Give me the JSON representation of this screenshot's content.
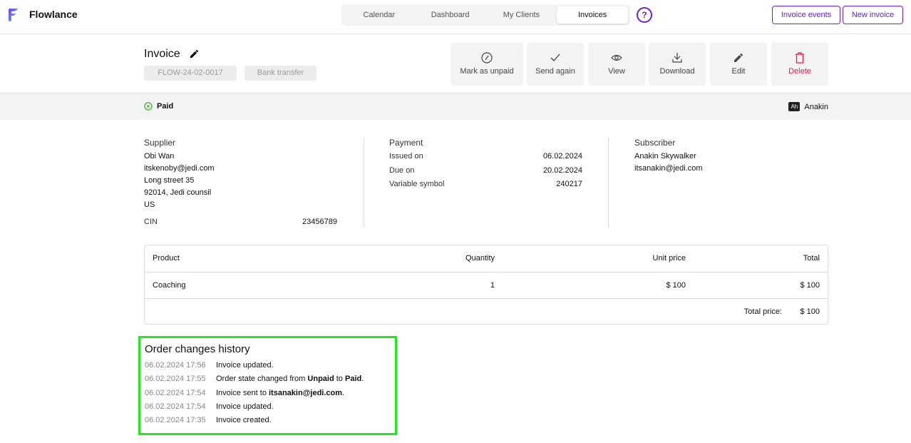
{
  "app": {
    "name": "Flowlance"
  },
  "nav": {
    "tabs": [
      {
        "label": "Calendar"
      },
      {
        "label": "Dashboard"
      },
      {
        "label": "My Clients"
      },
      {
        "label": "Invoices",
        "active": true
      }
    ],
    "help": "?",
    "invoice_events": "Invoice events",
    "new_invoice": "New invoice"
  },
  "invoice": {
    "title": "Invoice",
    "number": "FLOW-24-02-0017",
    "payment_method": "Bank transfer"
  },
  "actions": [
    {
      "label": "Mark as unpaid",
      "icon": "slash-circle-icon"
    },
    {
      "label": "Send again",
      "icon": "check-icon"
    },
    {
      "label": "View",
      "icon": "eye-icon"
    },
    {
      "label": "Download",
      "icon": "download-icon"
    },
    {
      "label": "Edit",
      "icon": "pencil-icon"
    },
    {
      "label": "Delete",
      "icon": "trash-icon",
      "color": "#e8174f"
    }
  ],
  "status": {
    "label": "Paid",
    "color": "#7cbf6b",
    "user_initials": "Ah",
    "user": "Anakin"
  },
  "supplier": {
    "heading": "Supplier",
    "lines": [
      "Obi Wan",
      "itskenoby@jedi.com",
      "Long street 35",
      "92014, Jedi counsil",
      "US"
    ],
    "cin_label": "CIN",
    "cin": "23456789"
  },
  "payment": {
    "heading": "Payment",
    "rows": [
      {
        "k": "Issued on",
        "v": "06.02.2024"
      },
      {
        "k": "Due on",
        "v": "20.02.2024"
      },
      {
        "k": "Variable symbol",
        "v": "240217"
      }
    ]
  },
  "subscriber": {
    "heading": "Subscriber",
    "lines": [
      "Anakin Skywalker",
      "itsanakin@jedi.com"
    ]
  },
  "table": {
    "headers": [
      "Product",
      "Quantity",
      "Unit price",
      "Total"
    ],
    "rows": [
      [
        "Coaching",
        "1",
        "$ 100",
        "$ 100"
      ]
    ],
    "total_label": "Total price:",
    "total": "$ 100"
  },
  "history": {
    "title": "Order changes history",
    "items": [
      {
        "time": "06.02.2024 17:56",
        "parts": [
          {
            "t": "Invoice updated."
          }
        ]
      },
      {
        "time": "06.02.2024 17:55",
        "parts": [
          {
            "t": "Order state changed from "
          },
          {
            "t": "Unpaid",
            "b": true
          },
          {
            "t": " to "
          },
          {
            "t": "Paid",
            "b": true
          },
          {
            "t": "."
          }
        ]
      },
      {
        "time": "06.02.2024 17:54",
        "parts": [
          {
            "t": "Invoice sent to "
          },
          {
            "t": "itsanakin@jedi.com",
            "b": true
          },
          {
            "t": "."
          }
        ]
      },
      {
        "time": "06.02.2024 17:54",
        "parts": [
          {
            "t": "Invoice updated."
          }
        ]
      },
      {
        "time": "06.02.2024 17:35",
        "parts": [
          {
            "t": "Invoice created."
          }
        ]
      }
    ]
  }
}
